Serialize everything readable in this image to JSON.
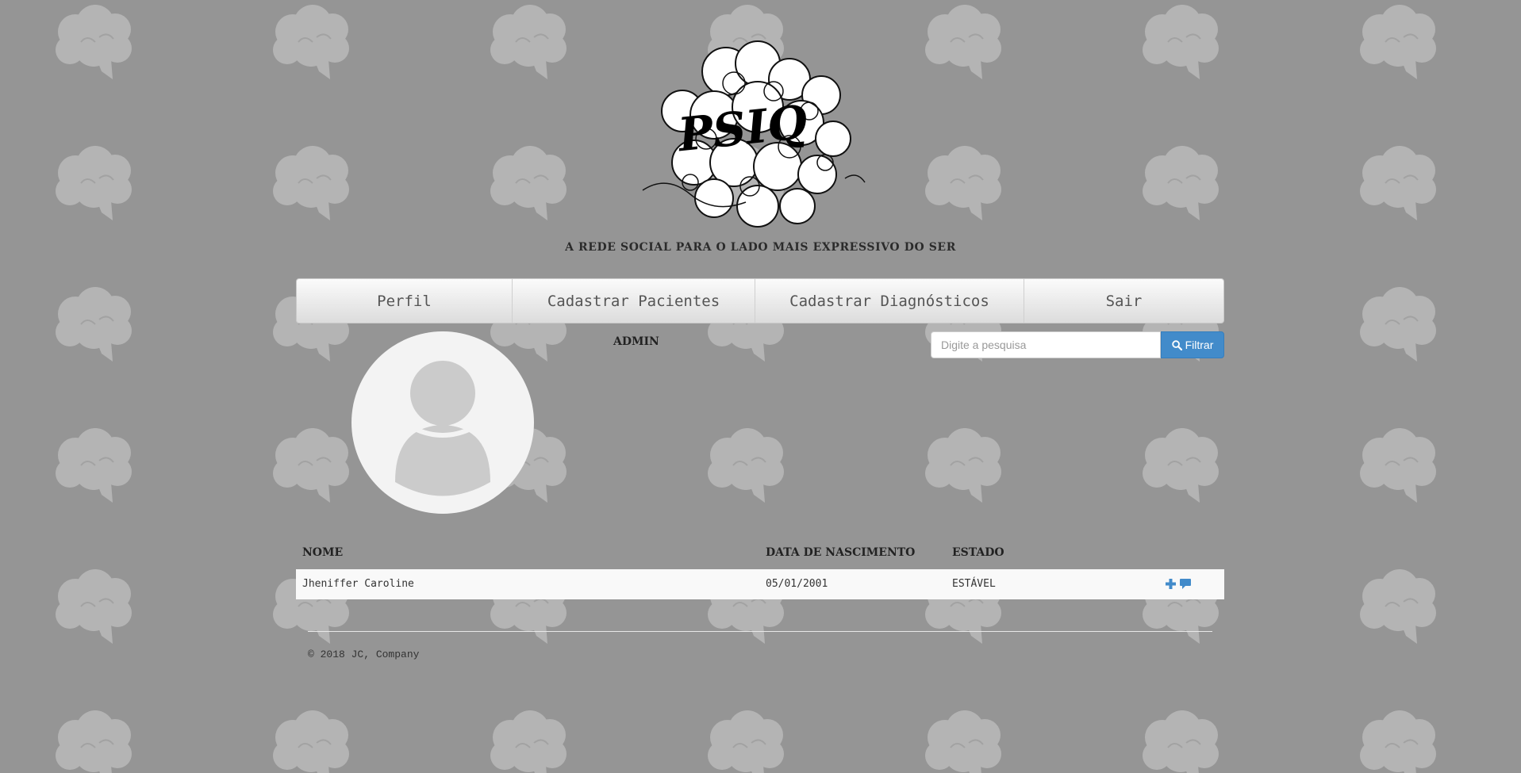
{
  "header": {
    "logo_text": "PSIQ",
    "tagline": "A rede social para o lado mais expressivo do ser"
  },
  "nav": {
    "items": [
      {
        "label": "Perfil"
      },
      {
        "label": "Cadastrar Pacientes"
      },
      {
        "label": "Cadastrar Diagnósticos"
      },
      {
        "label": "Sair"
      }
    ]
  },
  "profile": {
    "username": "ADMIN"
  },
  "search": {
    "placeholder": "Digite a pesquisa",
    "value": "",
    "button_label": "Filtrar"
  },
  "table": {
    "headers": [
      "Nome",
      "Data de Nascimento",
      "Estado",
      ""
    ],
    "rows": [
      {
        "name": "Jheniffer Caroline",
        "birth_date": "05/01/2001",
        "status": "ESTÁVEL",
        "actions": [
          "plus-icon",
          "comment-icon"
        ]
      }
    ]
  },
  "footer": {
    "copyright": "© 2018 JC, Company"
  },
  "colors": {
    "background": "#959595",
    "pattern": "#b4b4b4",
    "accent": "#428bca",
    "row_background": "#f9f9f9"
  }
}
